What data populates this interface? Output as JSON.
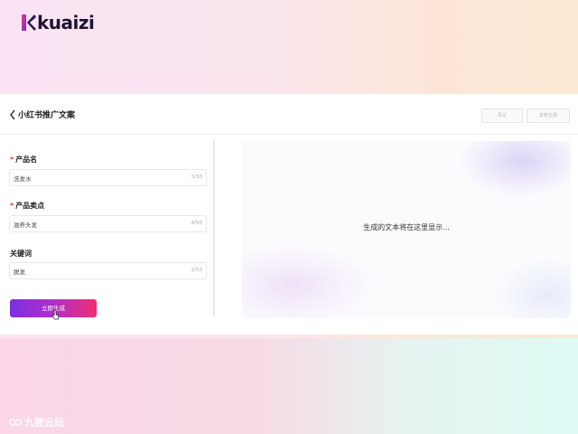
{
  "brand": {
    "logo_text": "kuaizi"
  },
  "header": {
    "title": "小红书推广文案",
    "buttons": [
      {
        "label": "再试"
      },
      {
        "label": "复制全部"
      }
    ]
  },
  "form": {
    "fields": [
      {
        "label": "产品名",
        "required": true,
        "value": "洗发水",
        "count": "3/30"
      },
      {
        "label": "产品卖点",
        "required": true,
        "value": "滋养头发",
        "count": "4/50"
      },
      {
        "label": "关键词",
        "required": false,
        "value": "脱发",
        "count": "2/50"
      }
    ],
    "submit_label": "立即生成"
  },
  "preview": {
    "placeholder": "生成的文本将在这里显示..."
  },
  "watermark": {
    "text": "九数云坛"
  },
  "colors": {
    "accent_start": "#7b2fe0",
    "accent_end": "#ef2f6e",
    "required": "#e53935"
  }
}
